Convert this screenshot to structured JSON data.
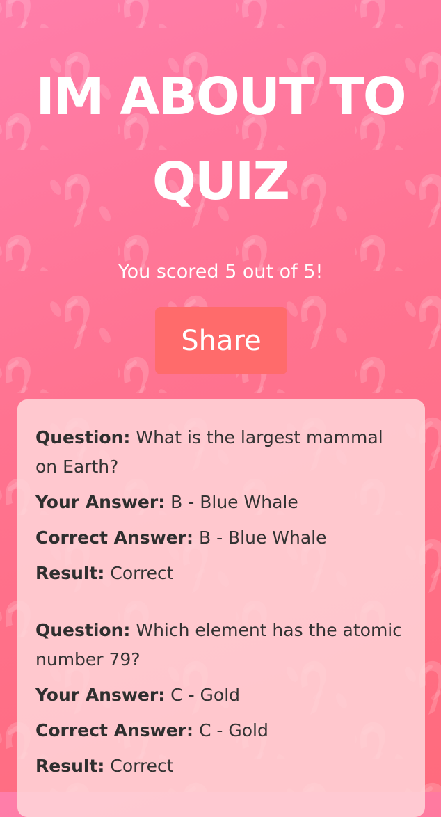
{
  "page": {
    "title": "IM ABOUT TO QUIZ",
    "score_text": "You scored 5 out of 5!",
    "share_label": "Share"
  },
  "colors": {
    "background_top": "#ff7eaa",
    "background_bottom": "#ff6b7d",
    "share_button": "#ff6b6b",
    "card": "#ffd6da",
    "text": "#333333"
  },
  "results": {
    "labels": {
      "question": "Question:",
      "your_answer": "Your Answer:",
      "correct_answer": "Correct Answer:",
      "result": "Result:"
    },
    "items": [
      {
        "question": "What is the largest mammal on Earth?",
        "your_answer": "B - Blue Whale",
        "correct_answer": "B - Blue Whale",
        "result": "Correct"
      },
      {
        "question": "Which element has the atomic number 79?",
        "your_answer": "C - Gold",
        "correct_answer": "C - Gold",
        "result": "Correct"
      }
    ]
  }
}
